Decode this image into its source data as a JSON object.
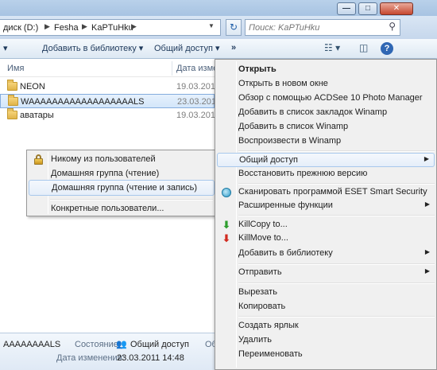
{
  "window": {
    "minimize_glyph": "—",
    "maximize_glyph": "□",
    "close_glyph": "✕"
  },
  "address": {
    "crumbs": [
      "диск (D:)",
      "Fesha",
      "KaPTuHku"
    ],
    "refresh_glyph": "↻"
  },
  "search": {
    "placeholder": "Поиск: KaPTuHku",
    "icon": "search-icon"
  },
  "toolbar": {
    "add_to_library": "Добавить в библиотеку",
    "share": "Общий доступ",
    "more": "»",
    "help": "?"
  },
  "columns": {
    "name": "Имя",
    "date": "Дата измене"
  },
  "files": [
    {
      "name": "NEON",
      "date": "19.03.2011 1"
    },
    {
      "name": "WAAAAAAAAAAAAAAAAAALS",
      "date": "23.03.2011 1"
    },
    {
      "name": "аватары",
      "date": "19.03.2011 1"
    }
  ],
  "sharing_submenu": {
    "items": [
      "Никому из пользователей",
      "Домашняя группа (чтение)",
      "Домашняя группа (чтение и запись)",
      "Конкретные пользователи..."
    ]
  },
  "context_menu": {
    "open": "Открыть",
    "open_new_window": "Открыть в новом окне",
    "acdsee": "Обзор с помощью ACDSee 10 Photo Manager",
    "winamp_bookmarks": "Добавить в список закладок Winamp",
    "winamp_list": "Добавить в список Winamp",
    "winamp_play": "Воспроизвести в Winamp",
    "share": "Общий доступ",
    "restore": "Восстановить прежнюю версию",
    "eset_scan": "Сканировать программой ESET Smart Security",
    "advanced": "Расширенные функции",
    "killcopy": "KillCopy to...",
    "killmove": "KillMove to...",
    "add_library": "Добавить в библиотеку",
    "send_to": "Отправить",
    "cut": "Вырезать",
    "copy": "Копировать",
    "create_shortcut": "Создать ярлык",
    "delete": "Удалить",
    "rename": "Переименовать"
  },
  "status": {
    "name": "AAAAAAAALS",
    "state_label": "Состояние:",
    "state_value": "Общий доступ",
    "state_extra": "Об",
    "modified_label": "Дата изменения:",
    "modified_value": "23.03.2011 14:48"
  }
}
